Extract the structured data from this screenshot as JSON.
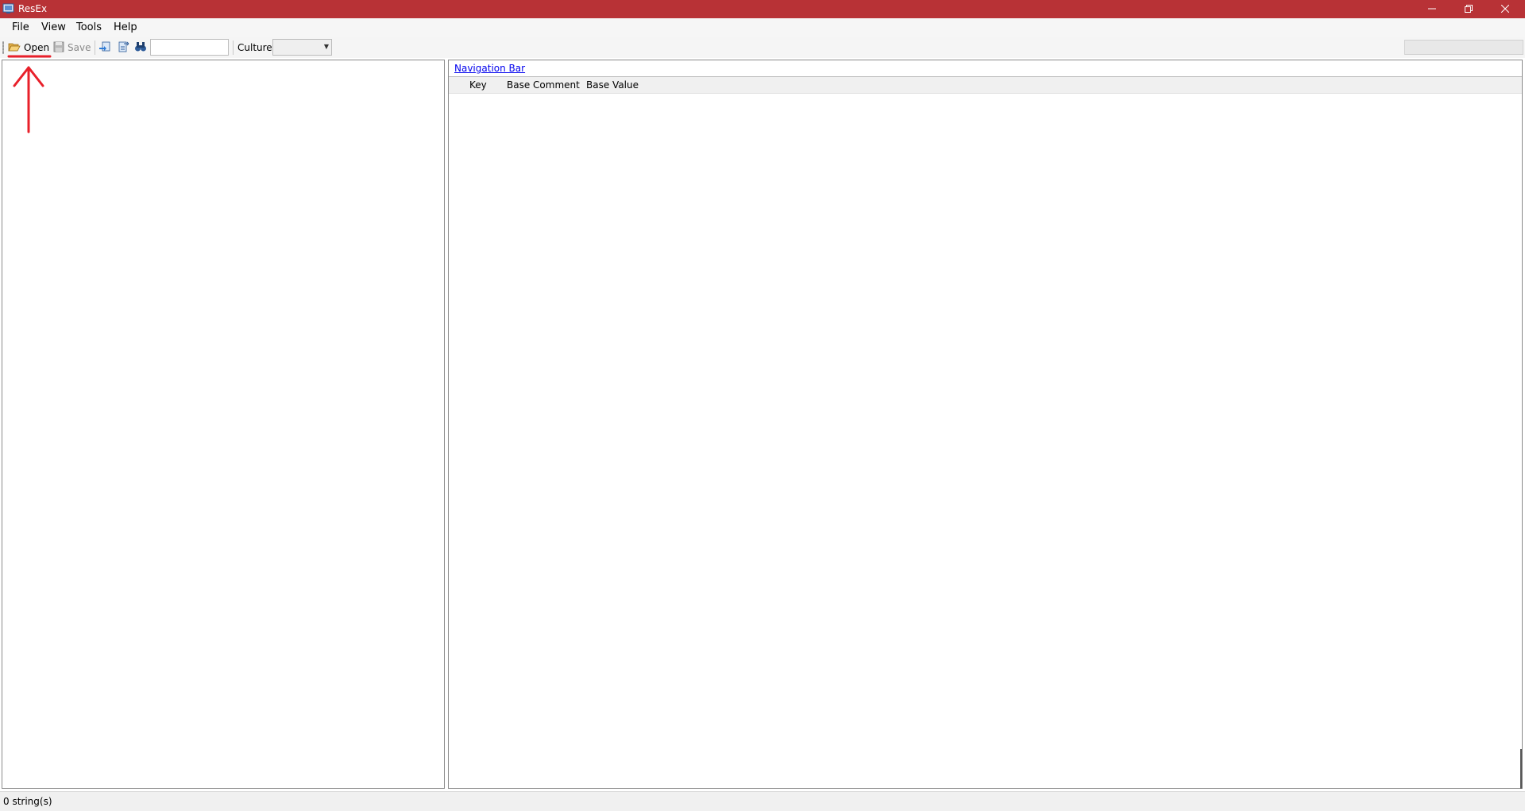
{
  "window": {
    "title": "ResEx"
  },
  "menu": {
    "items": [
      "File",
      "View",
      "Tools",
      "Help"
    ]
  },
  "toolbar": {
    "open_label": "Open",
    "save_label": "Save",
    "search": {
      "value": "",
      "placeholder": ""
    },
    "culture_label": "Culture",
    "culture_value": ""
  },
  "nav": {
    "link_text": "Navigation Bar"
  },
  "grid": {
    "columns": [
      "Key",
      "Base Comment",
      "Base Value"
    ]
  },
  "status": {
    "text": "0 string(s)"
  },
  "colors": {
    "titlebar": "#b83236",
    "annotation": "#e8202a",
    "link": "#0000ee"
  },
  "icons": [
    "app-icon",
    "minimize-icon",
    "restore-icon",
    "close-icon",
    "folder-open-icon",
    "save-icon",
    "import-icon",
    "export-icon",
    "find-icon"
  ]
}
